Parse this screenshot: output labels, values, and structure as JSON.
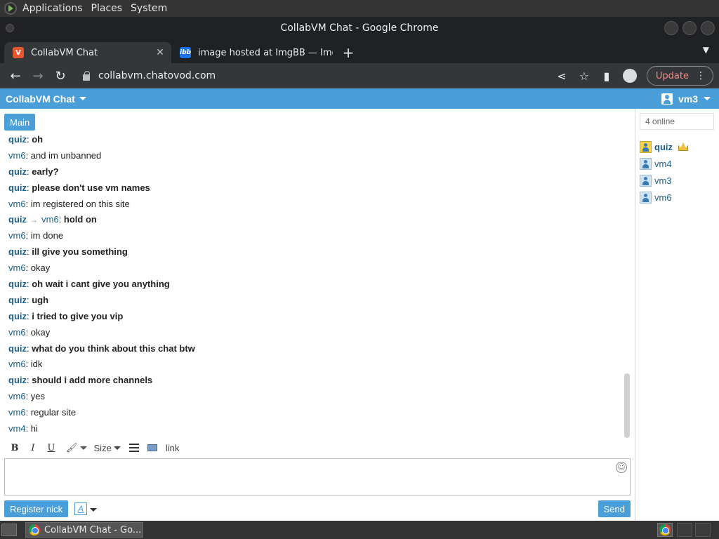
{
  "top_panel": {
    "menus": [
      "Applications",
      "Places",
      "System"
    ]
  },
  "window": {
    "title": "CollabVM Chat - Google Chrome"
  },
  "tabs": [
    {
      "title": "CollabVM Chat",
      "favicon": "collabvm-icon"
    },
    {
      "title": "image hosted at ImgBB — Img",
      "favicon": "ibb-icon",
      "favicon_text": "ibb"
    }
  ],
  "toolbar": {
    "url": "collabvm.chatovod.com",
    "update_label": "Update"
  },
  "page": {
    "brand": "CollabVM Chat",
    "current_user": "vm3",
    "channel_tab": "Main",
    "messages": [
      {
        "nick": "quiz",
        "op": true,
        "text": "oh"
      },
      {
        "nick": "vm6",
        "op": false,
        "text": "and im unbanned"
      },
      {
        "nick": "quiz",
        "op": true,
        "text": "early?"
      },
      {
        "nick": "quiz",
        "op": true,
        "text": "please don't use vm names"
      },
      {
        "nick": "vm6",
        "op": false,
        "text": "im registered on this site"
      },
      {
        "nick": "quiz",
        "op": true,
        "to": "vm6",
        "text": "hold on"
      },
      {
        "nick": "vm6",
        "op": false,
        "text": "im done"
      },
      {
        "nick": "quiz",
        "op": true,
        "text": "ill give you something"
      },
      {
        "nick": "vm6",
        "op": false,
        "text": "okay"
      },
      {
        "nick": "quiz",
        "op": true,
        "text": "oh wait i cant give you anything"
      },
      {
        "nick": "quiz",
        "op": true,
        "text": "ugh"
      },
      {
        "nick": "quiz",
        "op": true,
        "text": "i tried to give you vip"
      },
      {
        "nick": "vm6",
        "op": false,
        "text": "okay"
      },
      {
        "nick": "quiz",
        "op": true,
        "text": "what do you think about this chat btw"
      },
      {
        "nick": "vm6",
        "op": false,
        "text": "idk"
      },
      {
        "nick": "quiz",
        "op": true,
        "text": "should i add more channels"
      },
      {
        "nick": "vm6",
        "op": false,
        "text": "yes"
      },
      {
        "nick": "vm6",
        "op": false,
        "text": "regular site"
      },
      {
        "nick": "vm4",
        "op": false,
        "text": "hi"
      }
    ],
    "editor": {
      "bold": "B",
      "italic": "I",
      "underline": "U",
      "size_label": "Size",
      "link_label": "link"
    },
    "register_label": "Register nick",
    "format_toggle": "A",
    "send_label": "Send",
    "online_count": "4 online",
    "users": [
      {
        "name": "quiz",
        "op": true,
        "me": false
      },
      {
        "name": "vm4",
        "op": false,
        "me": false
      },
      {
        "name": "vm3",
        "op": false,
        "me": false
      },
      {
        "name": "vm6",
        "op": false,
        "me": false
      }
    ]
  },
  "taskbar": {
    "task_title": "CollabVM Chat - Go..."
  },
  "colors": {
    "accent": "#4a9fd8",
    "nick": "#1a5f8a",
    "update": "#f28b82"
  }
}
